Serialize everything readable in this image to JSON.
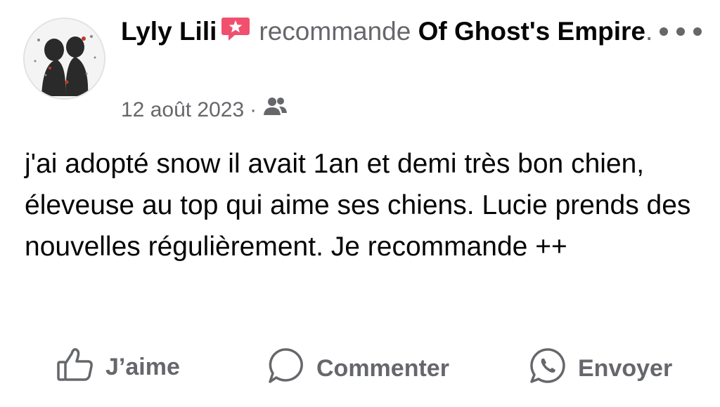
{
  "post": {
    "author": "Lyly Lili",
    "verb": "recommande",
    "page": "Of Ghost's Empire",
    "page_suffix": ".",
    "date": "12 août 2023",
    "date_separator": "·",
    "body": "j'ai adopté snow il avait 1an et demi très bon chien, éleveuse au top qui aime ses chiens. Lucie prends des nouvelles régulièrement. Je recommande ++",
    "badge_icon": "recommendation-star-icon",
    "audience_icon": "friends-audience-icon"
  },
  "actions": {
    "like_label": "J’aime",
    "comment_label": "Commenter",
    "send_label": "Envoyer"
  },
  "colors": {
    "text": "#050505",
    "secondary": "#65676b",
    "badge": "#f0506e"
  }
}
